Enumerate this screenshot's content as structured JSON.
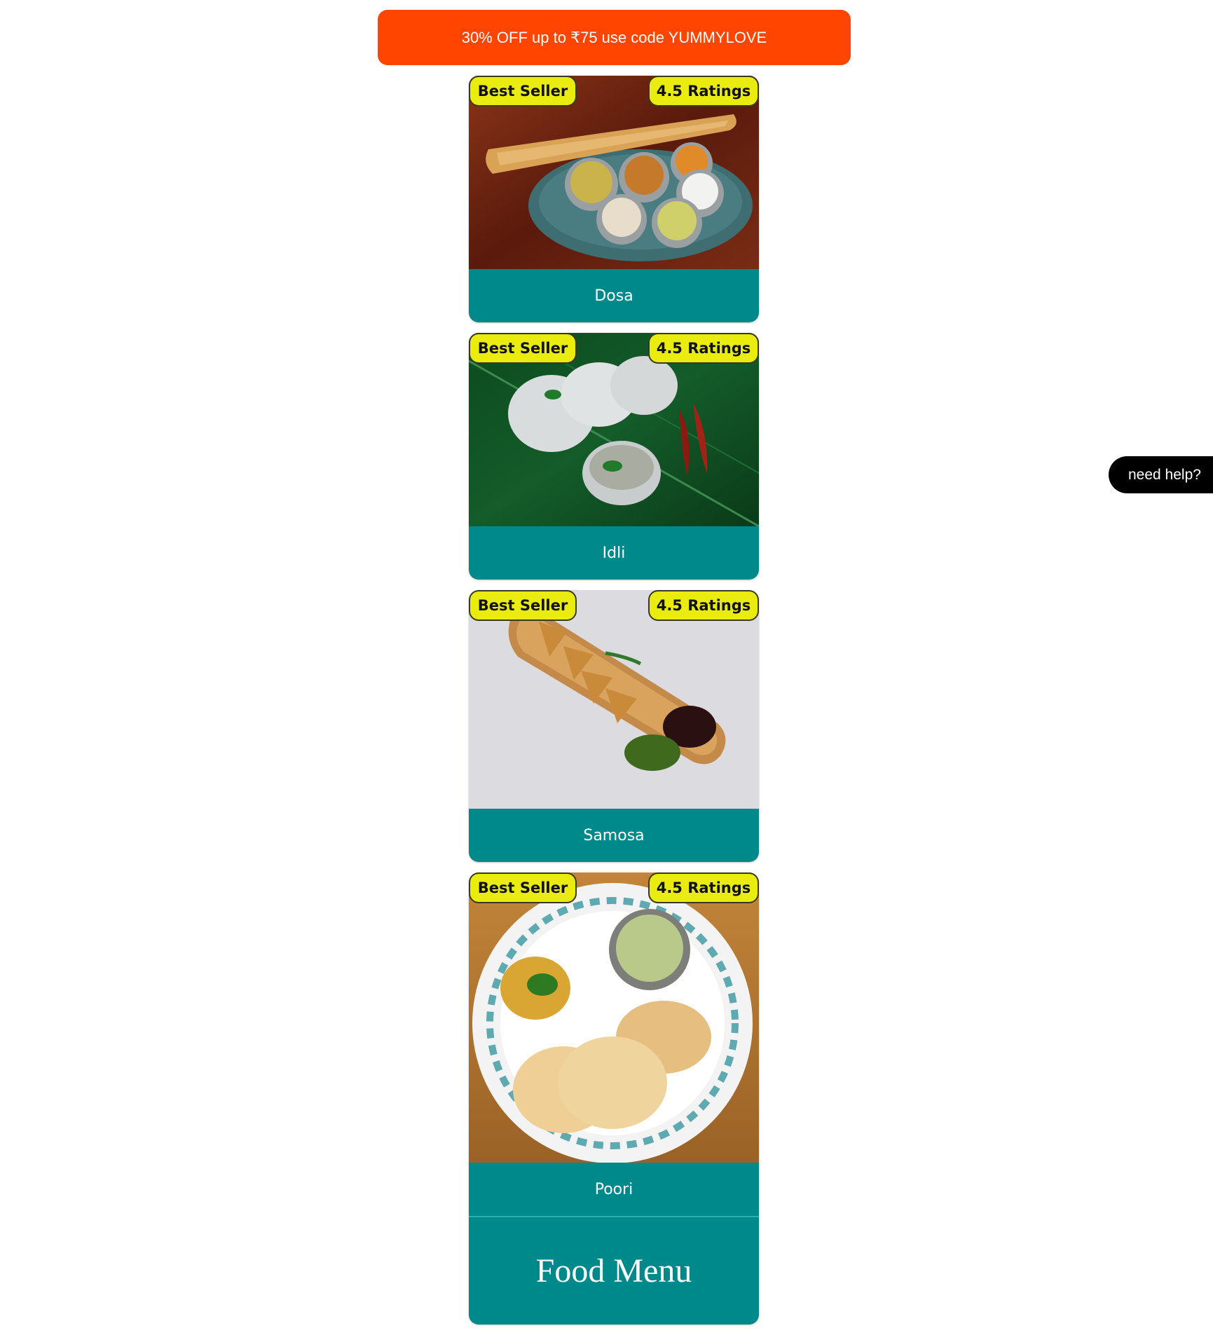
{
  "promo": {
    "text": "30% OFF up to ₹75 use code YUMMYLOVE",
    "bg_color": "#ff4500"
  },
  "items": [
    {
      "name": "Dosa",
      "badge_left": "Best Seller",
      "badge_right": "4.5 Ratings",
      "image": "dosa-photo"
    },
    {
      "name": "Idli",
      "badge_left": "Best Seller",
      "badge_right": "4.5 Ratings",
      "image": "idli-photo"
    },
    {
      "name": "Samosa",
      "badge_left": "Best Seller",
      "badge_right": "4.5 Ratings",
      "image": "samosa-photo"
    },
    {
      "name": "Poori",
      "badge_left": "Best Seller",
      "badge_right": "4.5 Ratings",
      "image": "poori-photo"
    }
  ],
  "menu": {
    "title": "Food Menu"
  },
  "help": {
    "label": "need help?"
  },
  "colors": {
    "card": "#00898a",
    "badge": "#e9ec0e",
    "accent": "#ff4500"
  }
}
